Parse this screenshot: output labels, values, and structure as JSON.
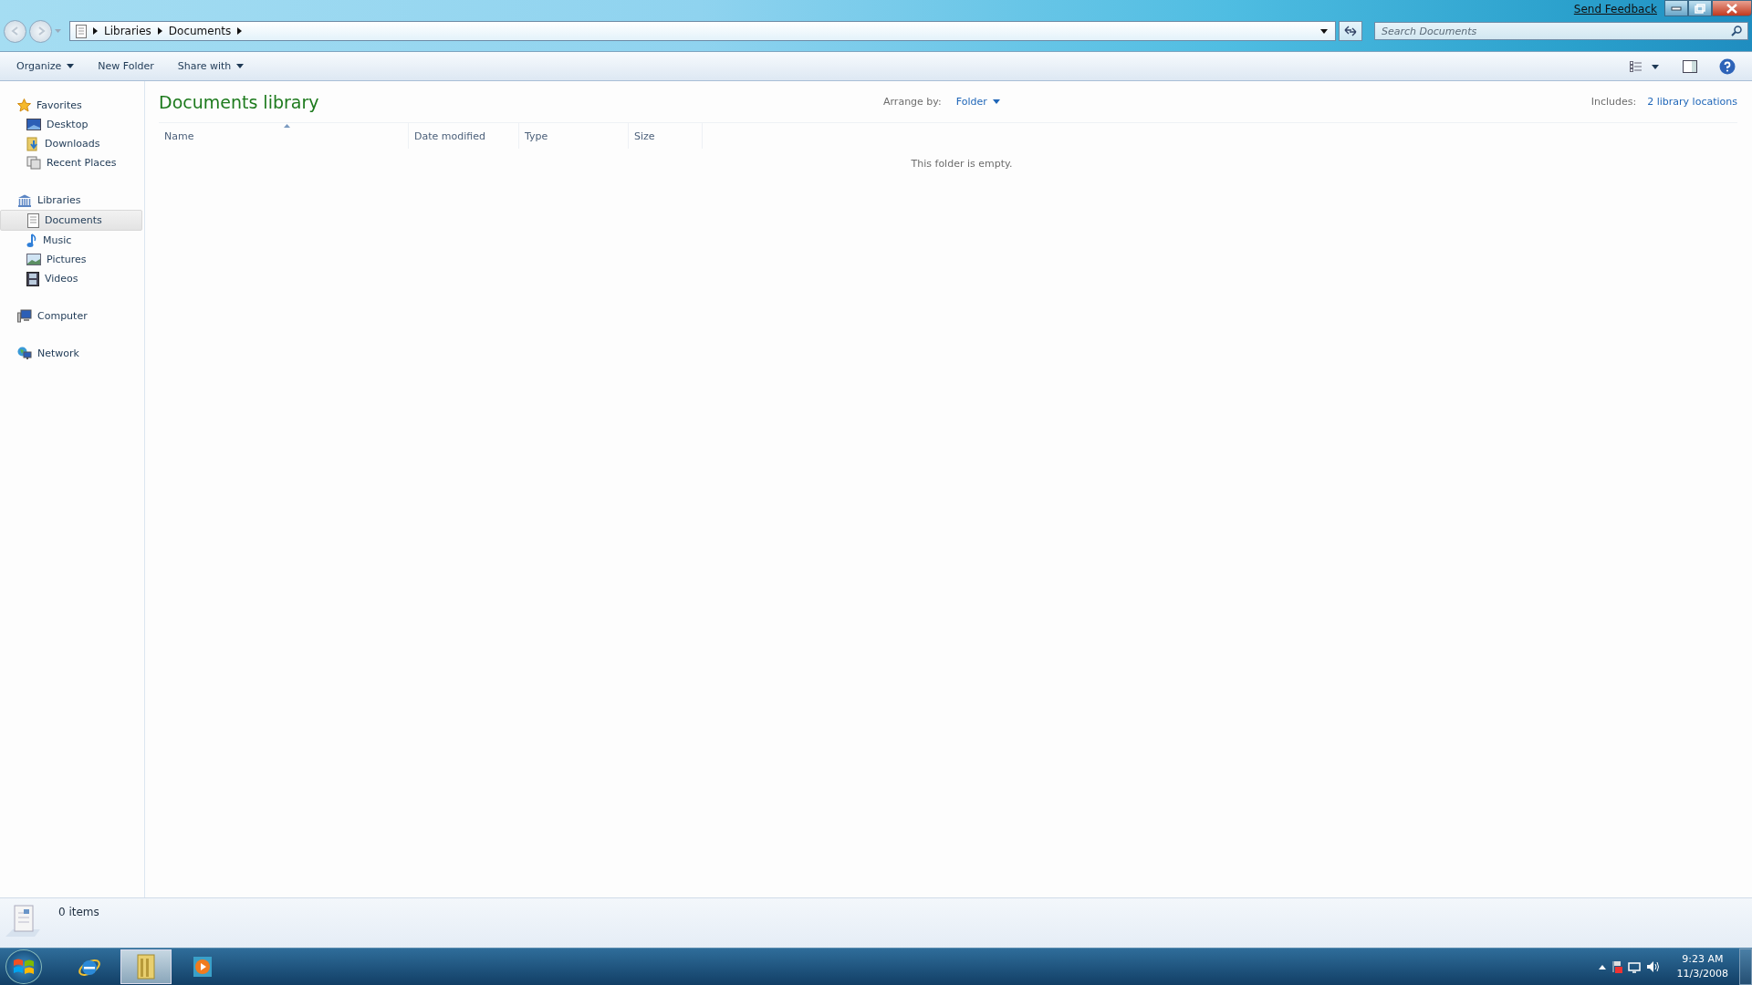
{
  "title_bar": {
    "feedback_link": "Send Feedback"
  },
  "address_bar": {
    "crumbs": [
      "Libraries",
      "Documents"
    ],
    "search": {
      "placeholder": "Search Documents"
    }
  },
  "toolbar": {
    "buttons": [
      {
        "label": "Organize",
        "dropdown": true
      },
      {
        "label": "New Folder",
        "dropdown": false
      },
      {
        "label": "Share with",
        "dropdown": true
      }
    ]
  },
  "sidebar": {
    "groups": [
      {
        "label": "Favorites",
        "selected": false,
        "children": [
          {
            "label": "Desktop",
            "selected": false
          },
          {
            "label": "Downloads",
            "selected": false
          },
          {
            "label": "Recent Places",
            "selected": false
          }
        ]
      },
      {
        "label": "Libraries",
        "selected": false,
        "children": [
          {
            "label": "Documents",
            "selected": true
          },
          {
            "label": "Music",
            "selected": false
          },
          {
            "label": "Pictures",
            "selected": false
          },
          {
            "label": "Videos",
            "selected": false
          }
        ]
      },
      {
        "label": "Computer",
        "selected": false
      },
      {
        "label": "Network",
        "selected": false
      }
    ]
  },
  "content": {
    "title": "Documents library",
    "arrange_label": "Arrange by:",
    "arrange_value": "Folder",
    "includes_label": "Includes:",
    "includes_link": "2 library locations",
    "columns": [
      {
        "label": "Name",
        "sorted": true
      },
      {
        "label": "Date modified",
        "sorted": false
      },
      {
        "label": "Type",
        "sorted": false
      },
      {
        "label": "Size",
        "sorted": false
      }
    ],
    "empty_message": "This folder is empty."
  },
  "status_bar": {
    "count": "0 items"
  },
  "taskbar": {
    "apps": [
      {
        "selected": false
      },
      {
        "selected": true
      },
      {
        "selected": false
      }
    ],
    "time": "9:23 AM",
    "date": "11/3/2008"
  }
}
